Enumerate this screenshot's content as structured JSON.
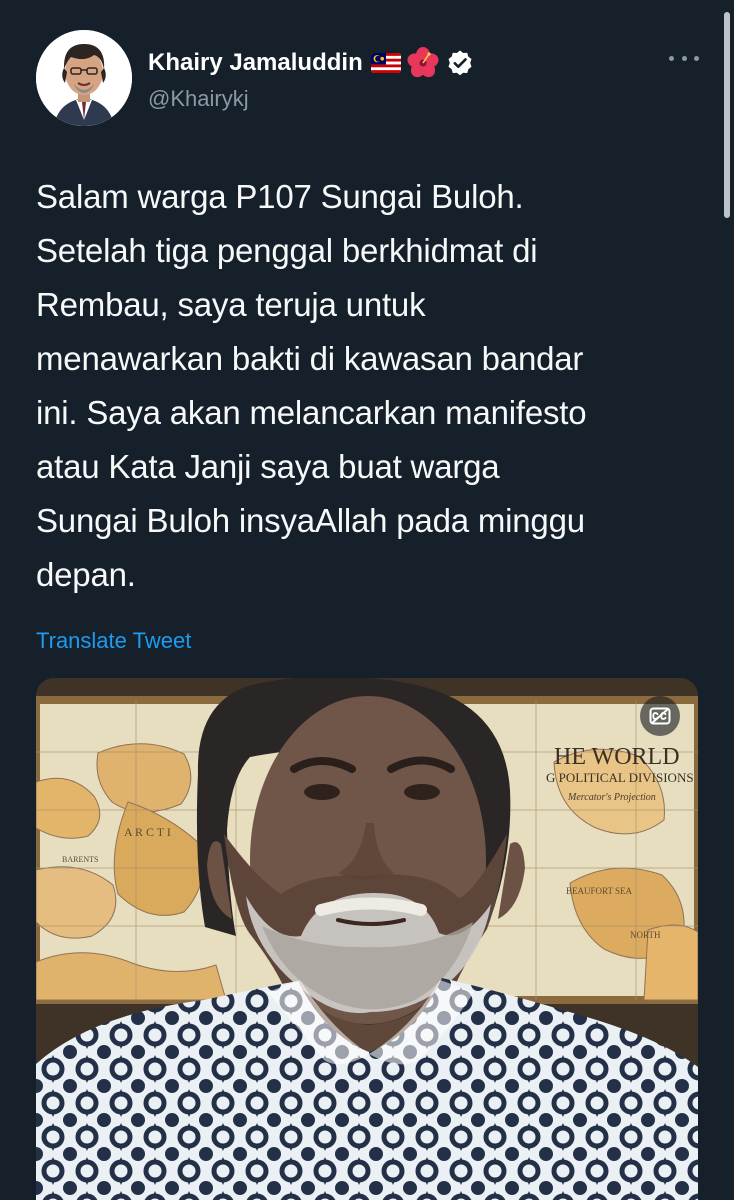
{
  "author": {
    "display_name": "Khairy Jamaluddin",
    "handle": "@Khairykj",
    "verified": true,
    "name_emoji": [
      "malaysia-flag-icon",
      "hibiscus-icon"
    ]
  },
  "tweet": {
    "text": "Salam warga P107 Sungai Buloh.\nSetelah tiga penggal berkhidmat di\nRembau, saya teruja untuk\nmenawarkan bakti di kawasan bandar\nini. Saya akan melancarkan manifesto\natau Kata Janji saya buat warga\nSungai Buloh insyaAllah pada minggu\ndepan.",
    "translate_label": "Translate Tweet"
  },
  "media": {
    "type": "video",
    "map_text": {
      "title": "HE WORLD",
      "subtitle": "G POLITICAL DIVISIONS",
      "projection": "Mercator's Projection",
      "arctic": "A R C T I",
      "barents": "BARENTS",
      "beaufort": "BEAUFORT SEA",
      "north": "NORTH"
    }
  },
  "colors": {
    "background": "#15202b",
    "text": "#f7f9f9",
    "secondary_text": "#8b98a5",
    "link": "#1d9bf0",
    "verified_badge": "#ffffff"
  }
}
